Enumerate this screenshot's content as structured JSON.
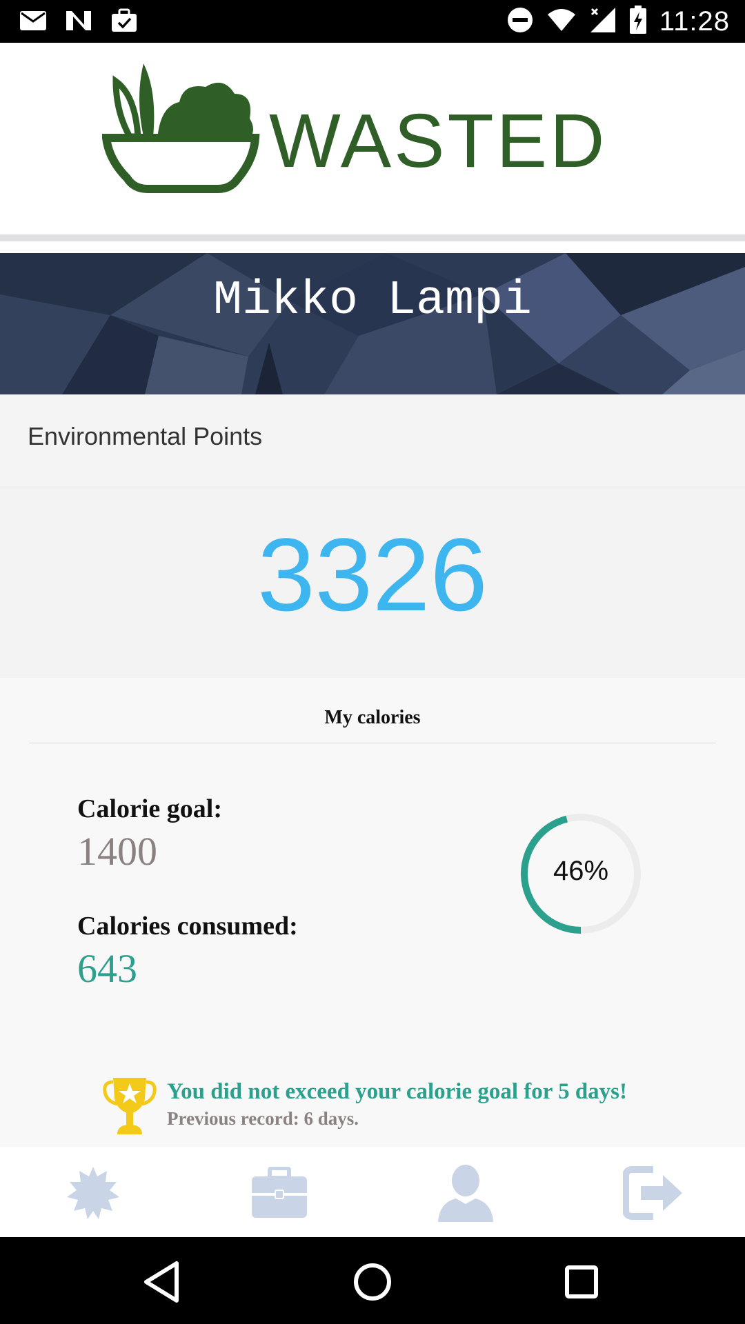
{
  "status_bar": {
    "time": "11:28",
    "left_icons": [
      "mail-icon",
      "n-logo-icon",
      "briefcase-check-icon"
    ],
    "right_icons": [
      "do-not-disturb-icon",
      "wifi-icon",
      "signal-icon",
      "battery-charging-icon"
    ]
  },
  "header": {
    "logo_text": "WASTED",
    "logo_color": "#2f5f27"
  },
  "profile": {
    "name": "Mikko Lampi"
  },
  "points": {
    "label": "Environmental Points",
    "value": "3326",
    "color": "#3db6f0"
  },
  "calories": {
    "title": "My calories",
    "goal_label": "Calorie goal:",
    "goal_value": "1400",
    "consumed_label": "Calories consumed:",
    "consumed_value": "643",
    "progress_text": "46%",
    "progress_fraction": 0.46,
    "accent_color": "#2ba08c"
  },
  "achievement": {
    "message": "You did not exceed your calorie goal for 5 days!",
    "previous_record": "Previous record: 6 days."
  },
  "bottom_nav": {
    "items": [
      "badge-icon",
      "briefcase-icon",
      "profile-icon",
      "logout-icon"
    ],
    "icon_color": "#c9d4e6"
  },
  "system_nav": [
    "back-icon",
    "home-icon",
    "recents-icon"
  ]
}
